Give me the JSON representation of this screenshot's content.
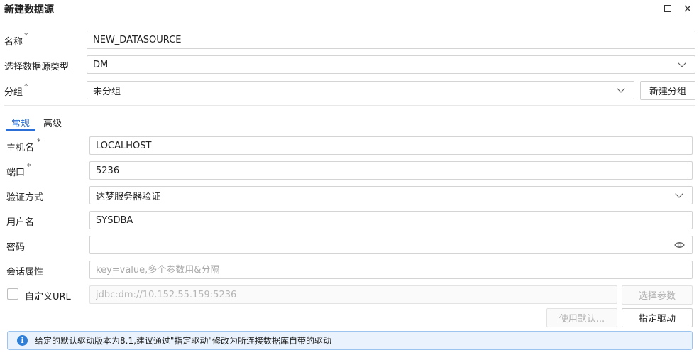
{
  "dialog": {
    "title": "新建数据源"
  },
  "form": {
    "name": {
      "label": "名称",
      "required": "*",
      "value": "NEW_DATASOURCE"
    },
    "type": {
      "label": "选择数据源类型",
      "value": "DM"
    },
    "group": {
      "label": "分组",
      "required": "*",
      "value": "未分组",
      "new_group_button": "新建分组"
    }
  },
  "tabs": [
    {
      "label": "常规",
      "active": true
    },
    {
      "label": "高级",
      "active": false
    }
  ],
  "general": {
    "host": {
      "label": "主机名",
      "required": "*",
      "value": "LOCALHOST"
    },
    "port": {
      "label": "端口",
      "required": "*",
      "value": "5236"
    },
    "auth": {
      "label": "验证方式",
      "value": "达梦服务器验证"
    },
    "username": {
      "label": "用户名",
      "value": "SYSDBA"
    },
    "password": {
      "label": "密码",
      "value": ""
    },
    "session": {
      "label": "会话属性",
      "placeholder": "key=value,多个参数用&分隔"
    },
    "custom_url": {
      "label": "自定义URL",
      "checked": false,
      "placeholder": "jdbc:dm://10.152.55.159:5236",
      "select_params_button": "选择参数"
    }
  },
  "driver": {
    "use_default_button": "使用默认...",
    "specify_driver_button": "指定驱动"
  },
  "info": {
    "message": "给定的默认驱动版本为8.1,建议通过\"指定驱动\"修改为所连接数据库自带的驱动"
  },
  "colors": {
    "accent": "#2b6fd6",
    "info_bg": "#eaf3fd",
    "info_border": "#9cc4ef",
    "info_icon": "#2f7fd8"
  },
  "icons": {
    "maximize": "maximize-icon",
    "close": "close-icon",
    "dropdown": "chevron-down-icon",
    "password_toggle": "eye-icon",
    "info": "info-icon"
  }
}
